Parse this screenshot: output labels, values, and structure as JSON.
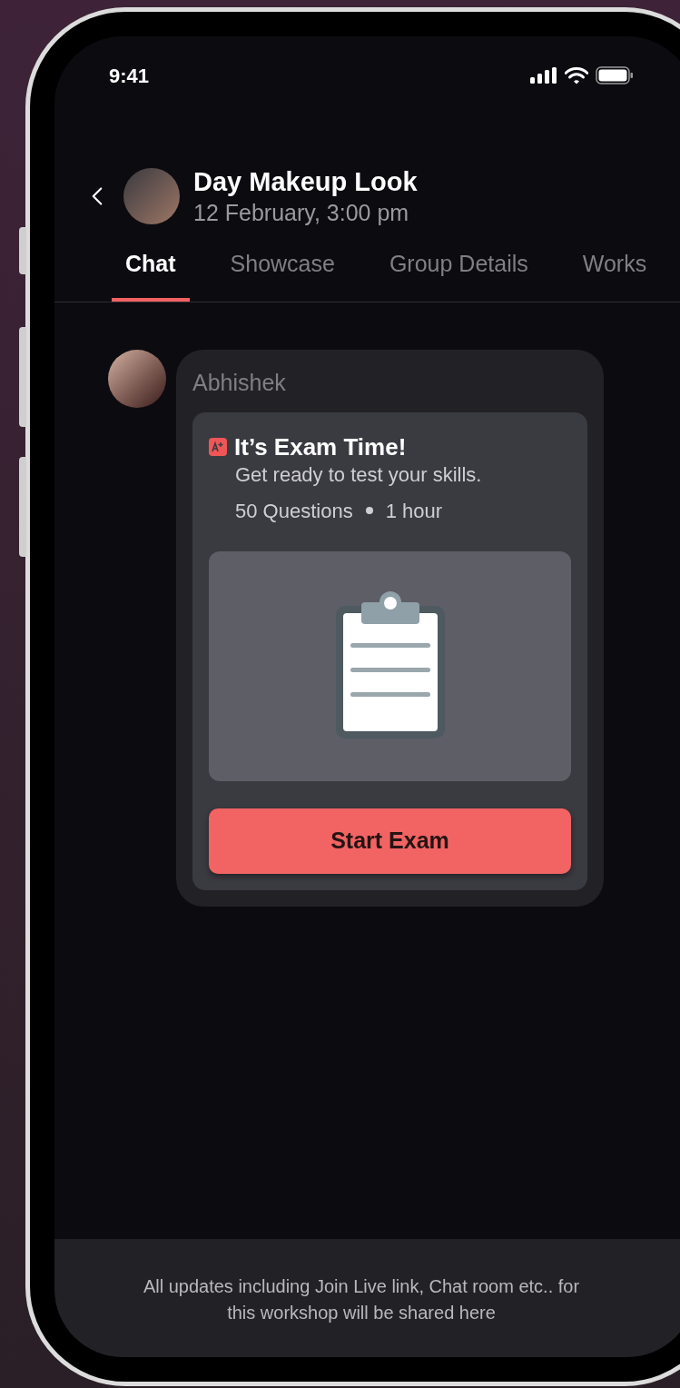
{
  "status_bar": {
    "time": "9:41"
  },
  "header": {
    "title": "Day Makeup Look",
    "subtitle": "12 February, 3:00 pm"
  },
  "tabs": [
    {
      "label": "Chat",
      "selected": true
    },
    {
      "label": "Showcase",
      "selected": false
    },
    {
      "label": "Group Details",
      "selected": false
    },
    {
      "label": "Works",
      "selected": false
    }
  ],
  "message": {
    "sender": "Abhishek",
    "card": {
      "title": "It’s Exam Time!",
      "subtitle": "Get ready to test your skills.",
      "questions": "50 Questions",
      "duration": "1 hour",
      "button": "Start Exam"
    }
  },
  "footer": {
    "text": "All updates including Join Live link, Chat room etc.. for this workshop will be shared here"
  }
}
